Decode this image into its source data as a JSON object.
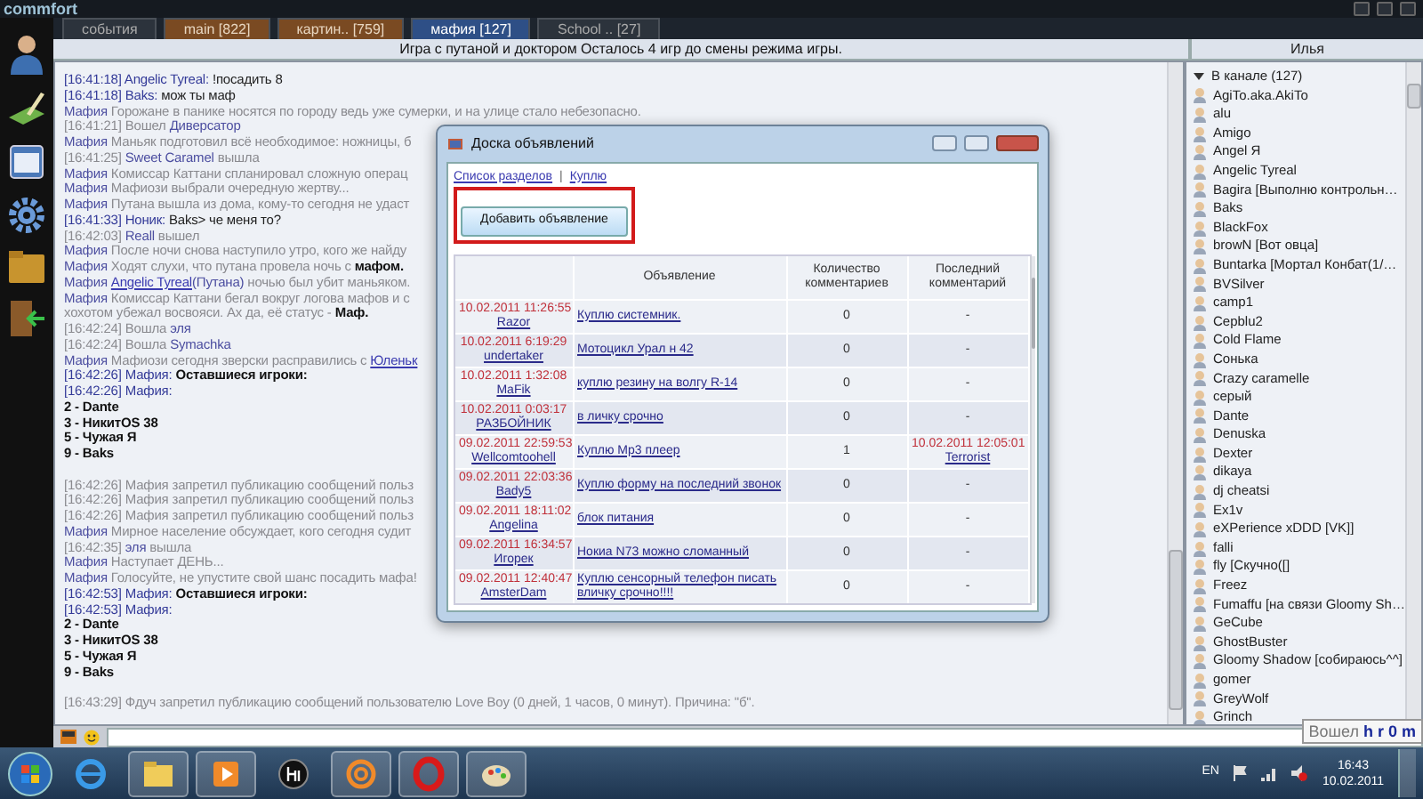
{
  "app": {
    "logo": "commfort"
  },
  "tabs": [
    {
      "label": "события",
      "selected": false,
      "unread": false
    },
    {
      "label": "main [822]",
      "selected": false,
      "unread": true
    },
    {
      "label": "картин.. [759]",
      "selected": false,
      "unread": true
    },
    {
      "label": "мафия [127]",
      "selected": true,
      "unread": false
    },
    {
      "label": "School .. [27]",
      "selected": false,
      "unread": false
    }
  ],
  "topic": "Игра с путаной и доктором Осталось 4 игр до смены режима игры.",
  "user_panel": {
    "title": "Илья",
    "group": "В канале (127)",
    "expanded": true,
    "users": [
      "AgiTo.aka.AkiTo",
      "alu",
      "Amigo",
      "Angel Я",
      "Angelic Tyreal",
      "Bagira [Выполню контрольн…",
      "Baks",
      "BlackFox",
      "browN [Вот овца]",
      "Buntarka [Мортал Конбат(1/…",
      "BVSilver",
      "camp1",
      "Cepblu2",
      "Cold Flame",
      "Сонька",
      "Crazy caramelle",
      "серый",
      "Dante",
      "Denuska",
      "Dexter",
      "dikaya",
      "dj cheatsi",
      "Ex1v",
      "eXPerience xDDD [VK]]",
      "falli",
      "fly [Скучно([]",
      "Freez",
      "Fumaffu [на связи Gloomy Sh…",
      "GeCube",
      "GhostBuster",
      "Gloomy Shadow [собираюсь^^]",
      "gomer",
      "GreyWolf",
      "Grinch"
    ]
  },
  "chat": {
    "lines": [
      {
        "parts": [
          {
            "kind": "time",
            "text": "[16:41:18] Angelic Tyreal:"
          },
          {
            "kind": "text",
            "text": " !посадить 8"
          }
        ]
      },
      {
        "parts": [
          {
            "kind": "time",
            "text": "[16:41:18] Baks:"
          },
          {
            "kind": "text",
            "text": " мож ты маф"
          }
        ]
      },
      {
        "parts": [
          {
            "kind": "nick",
            "text": "Мафия"
          },
          {
            "kind": "grey",
            "text": " Горожане в панике носятся по городу ведь уже сумерки, и на улице стало небезопасно."
          }
        ]
      },
      {
        "parts": [
          {
            "kind": "grey",
            "text": "[16:41:21] Вошел "
          },
          {
            "kind": "nick",
            "text": "Диверсатор"
          }
        ]
      },
      {
        "parts": [
          {
            "kind": "nick",
            "text": "Мафия"
          },
          {
            "kind": "grey",
            "text": " Маньяк подготовил всё необходимое: ножницы, б"
          }
        ]
      },
      {
        "parts": [
          {
            "kind": "grey",
            "text": "[16:41:25] "
          },
          {
            "kind": "nick",
            "text": "Sweet Caramel"
          },
          {
            "kind": "grey",
            "text": " вышла"
          }
        ]
      },
      {
        "parts": [
          {
            "kind": "nick",
            "text": "Мафия"
          },
          {
            "kind": "grey",
            "text": " Комиссар Каттани спланировал сложную операц"
          }
        ]
      },
      {
        "parts": [
          {
            "kind": "nick",
            "text": "Мафия"
          },
          {
            "kind": "grey",
            "text": " Мафиози выбрали очередную жертву..."
          }
        ]
      },
      {
        "parts": [
          {
            "kind": "nick",
            "text": "Мафия"
          },
          {
            "kind": "grey",
            "text": " Путана вышла из дома, кому-то сегодня не удаст"
          }
        ]
      },
      {
        "parts": [
          {
            "kind": "time",
            "text": "[16:41:33] Ноник:"
          },
          {
            "kind": "text",
            "text": " Baks> че меня то?"
          }
        ]
      },
      {
        "parts": [
          {
            "kind": "grey",
            "text": "[16:42:03] "
          },
          {
            "kind": "nick",
            "text": "Reall"
          },
          {
            "kind": "grey",
            "text": " вышел"
          }
        ]
      },
      {
        "parts": [
          {
            "kind": "nick",
            "text": "Мафия"
          },
          {
            "kind": "grey",
            "text": " После ночи снова наступило утро, кого же найду"
          }
        ]
      },
      {
        "parts": [
          {
            "kind": "nick",
            "text": "Мафия"
          },
          {
            "kind": "grey",
            "text": " Ходят слухи, что путана провела ночь с "
          },
          {
            "kind": "bold",
            "text": "мафом."
          }
        ]
      },
      {
        "parts": [
          {
            "kind": "nick",
            "text": "Мафия "
          },
          {
            "kind": "link",
            "text": "Angelic Tyreal"
          },
          {
            "kind": "nick",
            "text": "(Путана)"
          },
          {
            "kind": "grey",
            "text": " ночью был убит маньяком."
          }
        ]
      },
      {
        "parts": [
          {
            "kind": "nick",
            "text": "Мафия"
          },
          {
            "kind": "grey",
            "text": " Комиссар Каттани бегал вокруг логова мафов и с"
          }
        ]
      },
      {
        "parts": [
          {
            "kind": "grey",
            "text": "хохотом убежал восвояси. Ах да, её статус - "
          },
          {
            "kind": "bold",
            "text": "Маф."
          }
        ]
      },
      {
        "parts": [
          {
            "kind": "grey",
            "text": "[16:42:24] Вошла "
          },
          {
            "kind": "nick",
            "text": "эля"
          }
        ]
      },
      {
        "parts": [
          {
            "kind": "grey",
            "text": "[16:42:24] Вошла "
          },
          {
            "kind": "nick",
            "text": "Symachka"
          }
        ]
      },
      {
        "parts": [
          {
            "kind": "nick",
            "text": "Мафия"
          },
          {
            "kind": "grey",
            "text": " Мафиози сегодня зверски расправились с "
          },
          {
            "kind": "link",
            "text": "Юленьк"
          }
        ]
      },
      {
        "parts": [
          {
            "kind": "time",
            "text": "[16:42:26] Мафия:"
          },
          {
            "kind": "bold",
            "text": " Оставшиеся игроки:"
          }
        ]
      },
      {
        "parts": [
          {
            "kind": "time",
            "text": "[16:42:26] Мафия:"
          }
        ]
      },
      {
        "parts": [
          {
            "kind": "bold",
            "text": "2 - Dante"
          }
        ]
      },
      {
        "parts": [
          {
            "kind": "bold",
            "text": "3 - НикитOS 38"
          }
        ]
      },
      {
        "parts": [
          {
            "kind": "bold",
            "text": "5 - Чужая Я"
          }
        ]
      },
      {
        "parts": [
          {
            "kind": "bold",
            "text": "9 - Baks"
          }
        ]
      },
      {
        "gap_before": true,
        "parts": [
          {
            "kind": "grey",
            "text": "[16:42:26] Мафия запретил публикацию сообщений польз"
          }
        ]
      },
      {
        "parts": [
          {
            "kind": "grey",
            "text": "[16:42:26] Мафия запретил публикацию сообщений польз"
          }
        ]
      },
      {
        "parts": [
          {
            "kind": "grey",
            "text": "[16:42:26] Мафия запретил публикацию сообщений польз"
          }
        ]
      },
      {
        "parts": [
          {
            "kind": "nick",
            "text": "Мафия"
          },
          {
            "kind": "grey",
            "text": " Мирное население обсуждает, кого сегодня судит"
          }
        ]
      },
      {
        "parts": [
          {
            "kind": "grey",
            "text": "[16:42:35] "
          },
          {
            "kind": "nick",
            "text": "эля"
          },
          {
            "kind": "grey",
            "text": " вышла"
          }
        ]
      },
      {
        "parts": [
          {
            "kind": "nick",
            "text": "Мафия"
          },
          {
            "kind": "grey",
            "text": " Наступает ДЕНЬ..."
          }
        ]
      },
      {
        "parts": [
          {
            "kind": "nick",
            "text": "Мафия"
          },
          {
            "kind": "grey",
            "text": " Голосуйте, не упустите свой шанс посадить мафа!"
          }
        ]
      },
      {
        "parts": [
          {
            "kind": "time",
            "text": "[16:42:53] Мафия:"
          },
          {
            "kind": "bold",
            "text": " Оставшиеся игроки:"
          }
        ]
      },
      {
        "parts": [
          {
            "kind": "time",
            "text": "[16:42:53] Мафия:"
          }
        ]
      },
      {
        "parts": [
          {
            "kind": "bold",
            "text": "2 - Dante"
          }
        ]
      },
      {
        "parts": [
          {
            "kind": "bold",
            "text": "3 - НикитOS 38"
          }
        ]
      },
      {
        "parts": [
          {
            "kind": "bold",
            "text": "5 - Чужая Я"
          }
        ]
      },
      {
        "parts": [
          {
            "kind": "bold",
            "text": "9 - Baks"
          }
        ]
      },
      {
        "gap_before": true,
        "parts": [
          {
            "kind": "grey",
            "text": "[16:43:29] Фдуч запретил публикацию сообщений пользователю Love Boy (0 дней, 1 часов, 0 минут). Причина: \"б\"."
          }
        ]
      }
    ]
  },
  "board": {
    "title": "Доска объявлений",
    "breadcrumbs": [
      "Список разделов",
      "Куплю"
    ],
    "breadcrumb_separator": "|",
    "add_button": {
      "label": "Добавить объявление",
      "highlighted": true
    },
    "columns": [
      "Объявление",
      "Количество комментариев",
      "Последний комментарий"
    ],
    "rows": [
      {
        "date": "10.02.2011 11:26:55",
        "author": "Razor",
        "ad": "Куплю системник.",
        "comments": "0",
        "last_comment": {
          "kind": "none",
          "text": "-"
        }
      },
      {
        "date": "10.02.2011 6:19:29",
        "author": "undertaker",
        "ad": "Мотоцикл Урал н 42",
        "comments": "0",
        "last_comment": {
          "kind": "none",
          "text": "-"
        }
      },
      {
        "date": "10.02.2011 1:32:08",
        "author": "MaFik",
        "ad": "куплю резину на волгу R-14",
        "comments": "0",
        "last_comment": {
          "kind": "none",
          "text": "-"
        }
      },
      {
        "date": "10.02.2011 0:03:17",
        "author": "РАЗБОЙНИК",
        "ad": "в личку срочно",
        "comments": "0",
        "last_comment": {
          "kind": "none",
          "text": "-"
        }
      },
      {
        "date": "09.02.2011 22:59:53",
        "author": "Wellcomtoohell",
        "ad": "Куплю Mp3 плеер",
        "comments": "1",
        "last_comment": {
          "kind": "comment",
          "date": "10.02.2011 12:05:01",
          "author": "Terrorist"
        }
      },
      {
        "date": "09.02.2011 22:03:36",
        "author": "Bady5",
        "ad": "Куплю форму на последний звонок",
        "comments": "0",
        "last_comment": {
          "kind": "none",
          "text": "-"
        }
      },
      {
        "date": "09.02.2011 18:11:02",
        "author": "Angelina",
        "ad": "блок питания",
        "comments": "0",
        "last_comment": {
          "kind": "none",
          "text": "-"
        }
      },
      {
        "date": "09.02.2011 16:34:57",
        "author": "Игорек",
        "ad": "Нокиа N73 можно сломанный",
        "comments": "0",
        "last_comment": {
          "kind": "none",
          "text": "-"
        }
      },
      {
        "date": "09.02.2011 12:40:47",
        "author": "AmsterDam",
        "ad": "Куплю сенсорный телефон писать вличку срочно!!!!",
        "comments": "0",
        "last_comment": {
          "kind": "none",
          "text": "-"
        }
      }
    ]
  },
  "status": {
    "label": "Вошел",
    "user": "h r 0 m"
  },
  "taskbar": {
    "apps": [
      {
        "kind": "ie",
        "running": false
      },
      {
        "kind": "folder",
        "running": true
      },
      {
        "kind": "media",
        "running": true
      },
      {
        "kind": "hp",
        "running": false
      },
      {
        "kind": "mail",
        "running": true
      },
      {
        "kind": "opera",
        "running": true
      },
      {
        "kind": "paint",
        "running": true
      }
    ],
    "language": "EN",
    "time": "16:43",
    "date": "10.02.2011"
  }
}
